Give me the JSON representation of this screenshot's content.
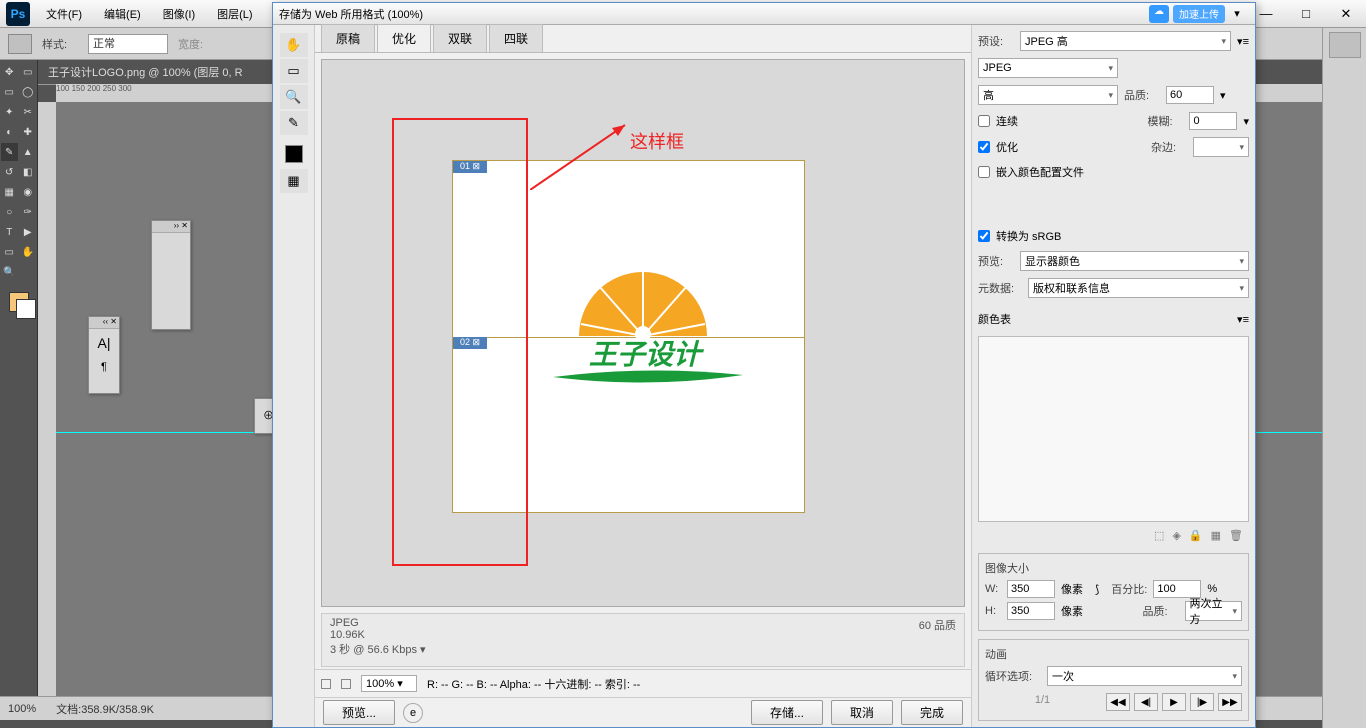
{
  "ps": {
    "menus": [
      "文件(F)",
      "编辑(E)",
      "图像(I)",
      "图层(L)"
    ],
    "style_label": "样式:",
    "style_value": "正常",
    "width_label": "宽度:",
    "doc_tab": "王子设计LOGO.png @ 100% (图层 0, R",
    "ruler_marks": "100        150        200        250        300",
    "status_zoom": "100%",
    "status_doc": "文档:358.9K/358.9K"
  },
  "sfw": {
    "title": "存储为 Web 所用格式 (100%)",
    "cloud_badge": "☁",
    "blue_badge": "加速上传",
    "tabs": [
      "原稿",
      "优化",
      "双联",
      "四联"
    ],
    "active_tab": 1,
    "slice01": "01 ⊠",
    "slice02": "02 ⊠",
    "annotation": "这样框",
    "logo_text": "王子设计",
    "info_format": "JPEG",
    "info_size": "10.96K",
    "info_time": "3 秒 @ 56.6 Kbps",
    "info_quality": "60 品质",
    "zoom": "100%",
    "readout": "R:  --    G:  --    B:  --          Alpha: --    十六进制: --        索引: --",
    "preview_btn": "预览...",
    "save_btn": "存储...",
    "cancel_btn": "取消",
    "done_btn": "完成",
    "right": {
      "preset_label": "预设:",
      "preset_value": "JPEG 高",
      "format": "JPEG",
      "quality_preset": "高",
      "quality_label": "品质:",
      "quality_value": "60",
      "progressive": "连续",
      "blur_label": "模糊:",
      "blur_value": "0",
      "optimized": "优化",
      "matte_label": "杂边:",
      "embed_profile": "嵌入颜色配置文件",
      "convert_srgb": "转换为 sRGB",
      "preview_label": "预览:",
      "preview_value": "显示器颜色",
      "metadata_label": "元数据:",
      "metadata_value": "版权和联系信息",
      "colortable_title": "颜色表",
      "imagesize_title": "图像大小",
      "w_label": "W:",
      "w_value": "350",
      "h_label": "H:",
      "h_value": "350",
      "px": "像素",
      "percent_label": "百分比:",
      "percent_value": "100",
      "percent_unit": "%",
      "resample_label": "品质:",
      "resample_value": "两次立方",
      "anim_title": "动画",
      "loop_label": "循环选项:",
      "loop_value": "一次",
      "frame": "1/1"
    }
  }
}
